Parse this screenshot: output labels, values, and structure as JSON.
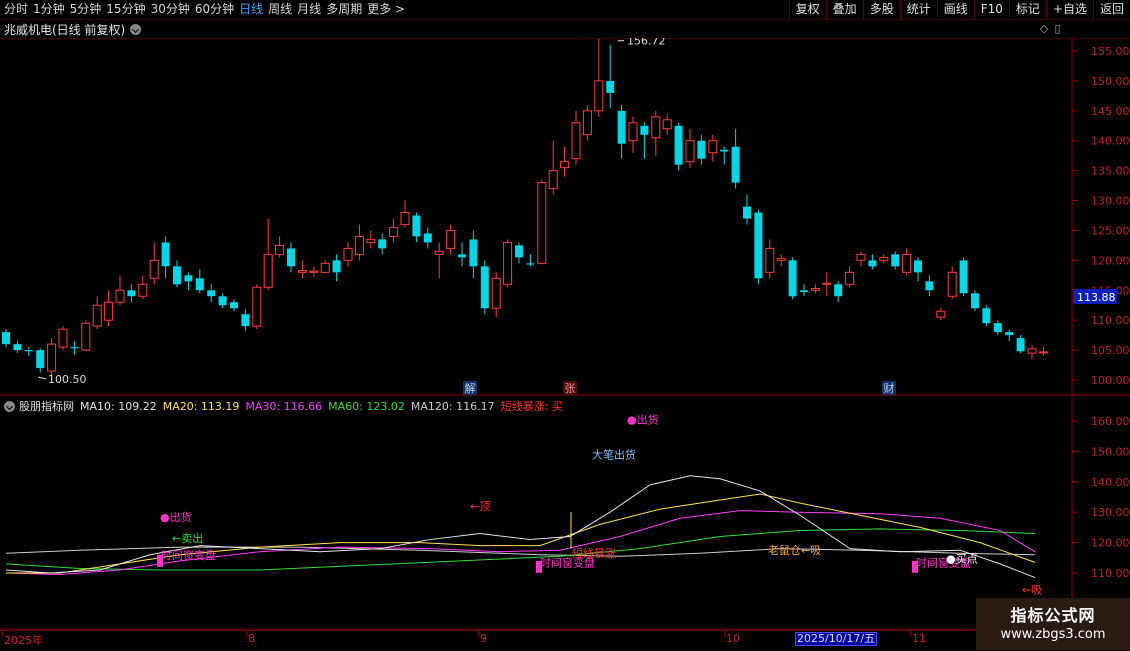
{
  "toolbar": {
    "periods": [
      "分时",
      "1分钟",
      "5分钟",
      "15分钟",
      "30分钟",
      "60分钟",
      "日线",
      "周线",
      "月线",
      "多周期",
      "更多 >"
    ],
    "active_period": "日线",
    "buttons": [
      "复权",
      "叠加",
      "多股",
      "统计",
      "画线",
      "F10",
      "标记",
      "+自选",
      "返回"
    ]
  },
  "stock_title": "兆威机电(日线 前复权)",
  "price_panel": {
    "y_ticks": [
      "155.00",
      "150.00",
      "145.00",
      "140.00",
      "135.00",
      "130.00",
      "125.00",
      "120.00",
      "115.00",
      "110.00",
      "105.00",
      "100.00"
    ],
    "current_price": "113.88",
    "high_label": "156.72",
    "low_label": "100.50",
    "event_tags": [
      "解",
      "张",
      "财"
    ],
    "colors": {
      "up": "#ff3c3c",
      "down": "#00d8e8",
      "grid": "#5a0000",
      "axis": "#c02020"
    }
  },
  "indicator": {
    "name": "股朋指标网",
    "ma_labels": [
      {
        "text": "MA10: 109.22",
        "color": "#e6e6e6"
      },
      {
        "text": "MA20: 113.19",
        "color": "#ffe24a"
      },
      {
        "text": "MA30: 116.66",
        "color": "#ff3cff"
      },
      {
        "text": "MA60: 123.02",
        "color": "#33dd33"
      },
      {
        "text": "MA120: 116.17",
        "color": "#cccccc"
      },
      {
        "text": "短线暴涨: 买",
        "color": "#ff3030"
      }
    ],
    "y_ticks": [
      "160.00",
      "150.00",
      "140.00",
      "130.00",
      "120.00",
      "110.00"
    ],
    "annotations": {
      "sell1": "●出货",
      "sell2": "●出货",
      "big_sell": "大笔出货",
      "sell_out": "←卖出",
      "top": "←顶",
      "window1": "时间窗变盘",
      "window2": "时间窗变盘",
      "window3": "时间窗变盘",
      "surge": "短线暴涨",
      "rat": "老鼠仓←吸",
      "absorb": "←吸",
      "buy_point": "●买点",
      "absorb2": "←吸"
    }
  },
  "date_axis": {
    "labels": [
      "2025年",
      "8",
      "9",
      "10",
      "11"
    ],
    "selected_date": "2025/10/17/五"
  },
  "watermark": {
    "title": "指标公式网",
    "url": "www.zbgs3.com"
  }
}
